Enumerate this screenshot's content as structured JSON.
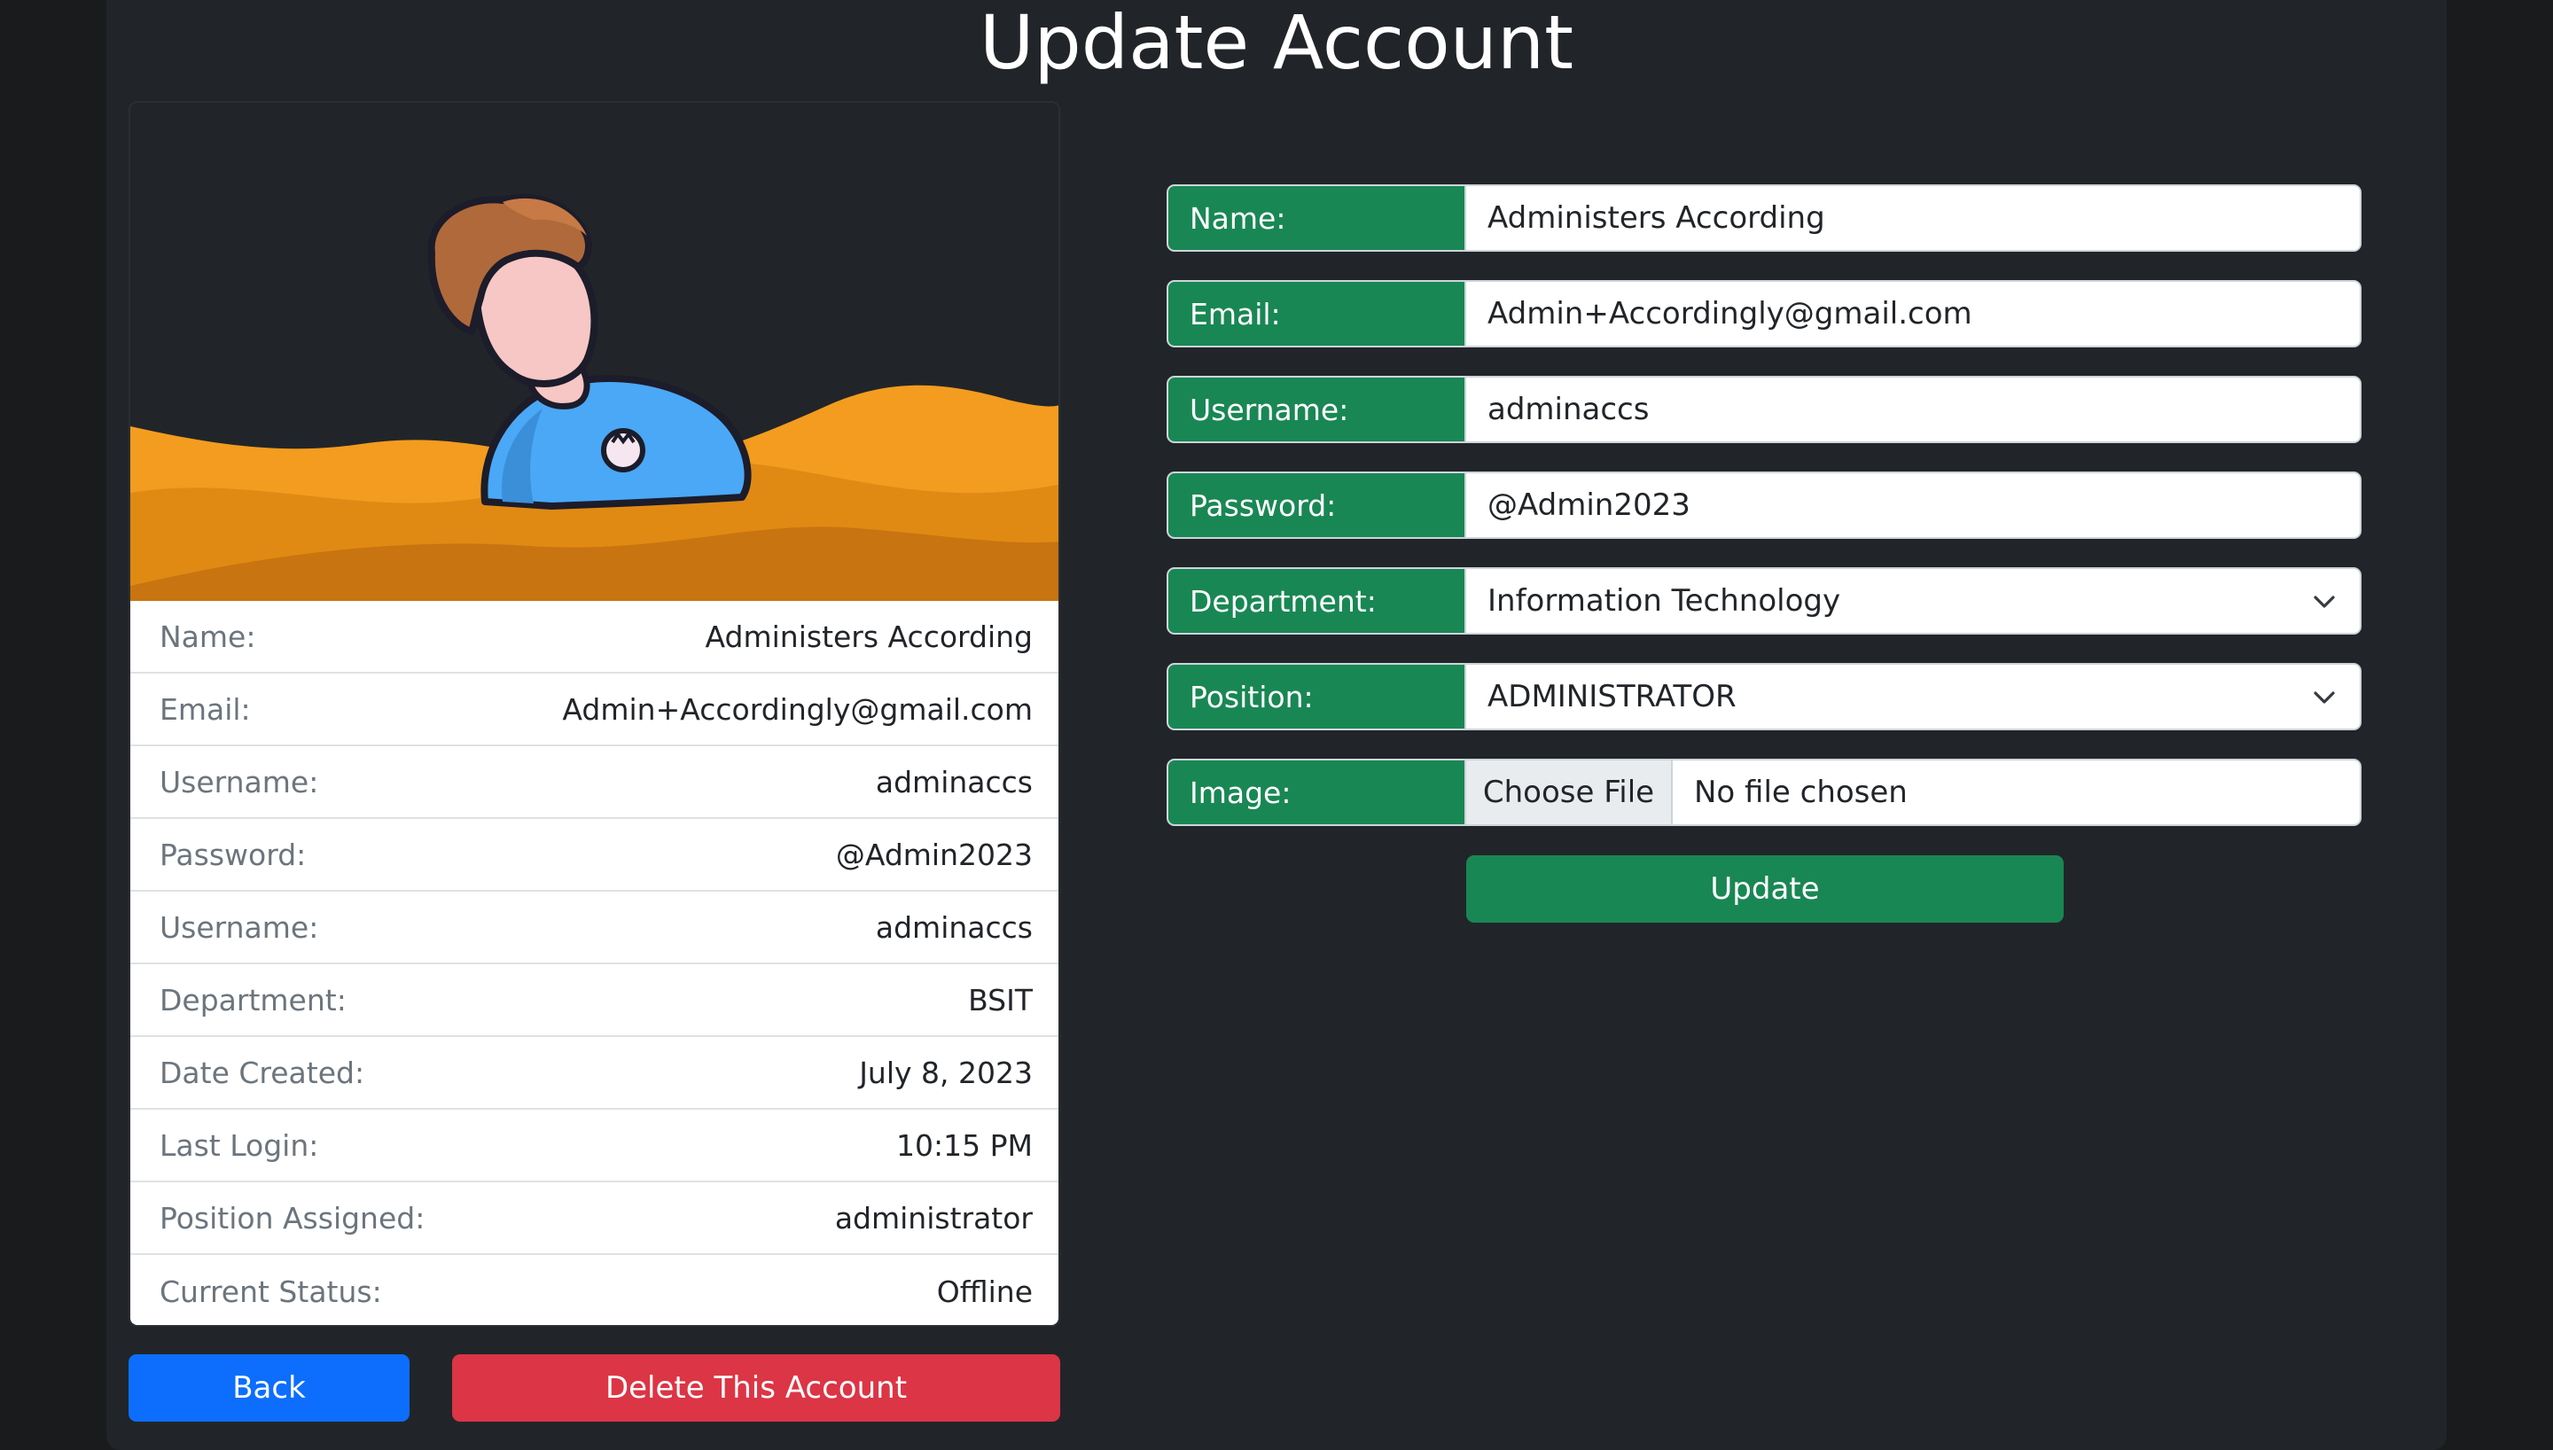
{
  "page": {
    "title": "Update Account"
  },
  "profile": {
    "rows": [
      {
        "label": "Name:",
        "value": "Administers According"
      },
      {
        "label": "Email:",
        "value": "Admin+Accordingly@gmail.com"
      },
      {
        "label": "Username:",
        "value": "adminaccs"
      },
      {
        "label": "Password:",
        "value": "@Admin2023"
      },
      {
        "label": "Username:",
        "value": "adminaccs"
      },
      {
        "label": "Department:",
        "value": "BSIT"
      },
      {
        "label": "Date Created:",
        "value": "July 8, 2023"
      },
      {
        "label": "Last Login:",
        "value": "10:15 PM"
      },
      {
        "label": "Position Assigned:",
        "value": "administrator"
      },
      {
        "label": "Current Status:",
        "value": "Offline"
      }
    ]
  },
  "buttons": {
    "back": "Back",
    "delete": "Delete This Account",
    "update": "Update"
  },
  "form": {
    "name": {
      "label": "Name:",
      "value": "Administers According"
    },
    "email": {
      "label": "Email:",
      "value": "Admin+Accordingly@gmail.com"
    },
    "username": {
      "label": "Username:",
      "value": "adminaccs"
    },
    "password": {
      "label": "Password:",
      "value": "@Admin2023"
    },
    "department": {
      "label": "Department:",
      "value": "Information Technology"
    },
    "position": {
      "label": "Position:",
      "value": "ADMINISTRATOR"
    },
    "image": {
      "label": "Image:",
      "button": "Choose File",
      "status": "No file chosen"
    }
  },
  "colors": {
    "background": "#1a1b1d",
    "panel": "#212529",
    "success": "#198754",
    "primary": "#0d6efd",
    "danger": "#dc3545",
    "wave": "#f39c1f"
  },
  "icons": {
    "avatar": "person-avatar-illustration",
    "department_select": "chevron-down-icon",
    "position_select": "chevron-down-icon"
  }
}
